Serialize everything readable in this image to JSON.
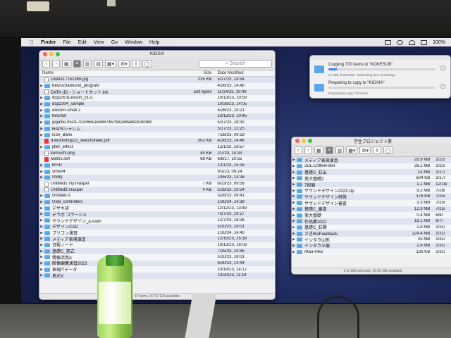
{
  "menubar": {
    "apple_glyph": "",
    "items": [
      "Finder",
      "File",
      "Edit",
      "View",
      "Go",
      "Window",
      "Help"
    ],
    "battery": "100%"
  },
  "main_window": {
    "title": "KIOXIA",
    "search_placeholder": "Search",
    "columns": {
      "name": "Name",
      "size": "Size",
      "date": "Date Modified"
    },
    "rows": [
      {
        "indent": 0,
        "kind": "file",
        "expand": "",
        "name": "1684317152369.jpg",
        "size": "235 KB",
        "date": "5/17/23, 18:54"
      },
      {
        "indent": 0,
        "kind": "folder",
        "expand": "▶",
        "name": "bel2023arduino_program",
        "size": "",
        "date": "4/26/23, 14:46"
      },
      {
        "indent": 0,
        "kind": "file",
        "expand": "",
        "name": "DATA (D) - ショートカット.lnk",
        "size": "503 bytes",
        "date": "11/14/23, 10:49"
      },
      {
        "indent": 0,
        "kind": "folder",
        "expand": "▶",
        "name": "dcp2301Lesson_v1-2",
        "size": "",
        "date": "10/13/23, 10:58"
      },
      {
        "indent": 0,
        "kind": "folder",
        "expand": "▶",
        "name": "dcp2304_sample",
        "size": "",
        "date": "10/26/23, 14:05"
      },
      {
        "indent": 0,
        "kind": "folder",
        "expand": "▶",
        "name": "elecom-small 2",
        "size": "",
        "date": "5/26/23, 10:21"
      },
      {
        "indent": 0,
        "kind": "folder",
        "expand": "▶",
        "name": "forumel",
        "size": "",
        "date": "10/13/23, 10:45"
      },
      {
        "indent": 0,
        "kind": "folder",
        "expand": "▶",
        "name": "gigafile-0524-702c661a53d87467bfe268a8d2818384",
        "size": "",
        "date": "5/17/23, 18:32"
      },
      {
        "indent": 0,
        "kind": "folder",
        "expand": "▶",
        "name": "HAPSシャレム",
        "size": "",
        "date": "5/17/23, 13:25"
      },
      {
        "indent": 0,
        "kind": "folder",
        "expand": "▶",
        "name": "Icon_Bank",
        "size": "",
        "date": "7/28/23, 09:19"
      },
      {
        "indent": 0,
        "kind": "pdf",
        "expand": "",
        "name": "IDworkshop23_sketchsheet.pdf",
        "size": "502 KB",
        "date": "4/26/23, 14:46"
      },
      {
        "indent": 0,
        "kind": "folder",
        "expand": "▶",
        "name": "jitter_effect",
        "size": "",
        "date": "12/1/23, 16:57"
      },
      {
        "indent": 0,
        "kind": "file",
        "expand": "",
        "name": "kemushi.png",
        "size": "40 KB",
        "date": "2/7/23, 14:33"
      },
      {
        "indent": 0,
        "kind": "pdf",
        "expand": "",
        "name": "Matrix.swf",
        "size": "68 KB",
        "date": "6/8/17, 10:55"
      },
      {
        "indent": 0,
        "kind": "folder",
        "expand": "▶",
        "name": "RFID",
        "size": "",
        "date": "12/1/23, 15:16"
      },
      {
        "indent": 0,
        "kind": "folder",
        "expand": "▶",
        "name": "sinw04",
        "size": "",
        "date": "9/1/23, 09:24"
      },
      {
        "indent": 0,
        "kind": "folder",
        "expand": "▶",
        "name": "Utility",
        "size": "",
        "date": "10/6/23, 14:38"
      },
      {
        "indent": 0,
        "kind": "file",
        "expand": "",
        "name": "Untitled1 my.maxpat",
        "size": "7 KB",
        "date": "6/23/23, 09:56"
      },
      {
        "indent": 0,
        "kind": "file",
        "expand": "",
        "name": "Untitled3.maxpat",
        "size": "4 KB",
        "date": "5/19/23, 10:24"
      },
      {
        "indent": 0,
        "kind": "folder",
        "expand": "▶",
        "name": "Untitled-3",
        "size": "",
        "date": "5/26/23, 09:41"
      },
      {
        "indent": 0,
        "kind": "folder",
        "expand": "▶",
        "name": "USB_controllers",
        "size": "",
        "date": "1/30/24, 14:38"
      },
      {
        "indent": 0,
        "kind": "folder",
        "expand": "▶",
        "name": "デザキ研",
        "size": "",
        "date": "12/12/23, 13:49"
      },
      {
        "indent": 0,
        "kind": "folder",
        "expand": "▶",
        "name": "デラボ コラージュ",
        "size": "",
        "date": "7/27/23, 19:17"
      },
      {
        "indent": 0,
        "kind": "folder",
        "expand": "▶",
        "name": "サウンドデザイン_a.room",
        "size": "",
        "date": "12/7/23, 16:26"
      },
      {
        "indent": 0,
        "kind": "folder",
        "expand": "▶",
        "name": "デザインCAD",
        "size": "",
        "date": "5/10/23, 18:01"
      },
      {
        "indent": 0,
        "kind": "folder",
        "expand": "▶",
        "name": "プリコン演習",
        "size": "",
        "date": "1/10/24, 14:40"
      },
      {
        "indent": 0,
        "kind": "folder",
        "expand": "▶",
        "name": "メディア表現演習",
        "size": "",
        "date": "12/15/23, 15:16"
      },
      {
        "indent": 0,
        "kind": "folder",
        "expand": "▶",
        "name": "日程ノード",
        "size": "",
        "date": "10/13/23, 16:03"
      },
      {
        "indent": 0,
        "kind": "folder",
        "expand": "▶",
        "name": "基礎C_書式",
        "size": "",
        "date": "7/25/23, 10:45"
      },
      {
        "indent": 0,
        "kind": "folder",
        "expand": "▶",
        "name": "情報活用A",
        "size": "",
        "date": "5/10/23, 18:01"
      },
      {
        "indent": 0,
        "kind": "folder",
        "expand": "▶",
        "name": "映像編集演習2023",
        "size": "",
        "date": "6/30/23, 14:44"
      },
      {
        "indent": 0,
        "kind": "folder",
        "expand": "▶",
        "name": "表現ITデータ",
        "size": "",
        "date": "10/19/23, 14:17"
      },
      {
        "indent": 0,
        "kind": "folder",
        "expand": "▶",
        "name": "鳥光X",
        "size": "",
        "date": "10/20/23, 11:14"
      }
    ],
    "status": "47 items, 57.97 GB available"
  },
  "copy_dialog": {
    "items": [
      {
        "title": "Copying 700 items to \"KOKESUB\"",
        "subtitle": "1.7 MB of 20.9 MB - Estimating time remaining...",
        "progress": 0.08
      },
      {
        "title": "Preparing to copy to \"KIOXIA\"",
        "subtitle": "Preparing to copy 728 items",
        "progress": 0.0
      }
    ]
  },
  "second_window": {
    "title": "学生プロジェクト素",
    "rows": [
      {
        "name": "メディア表現演習",
        "size": "28.9 MB",
        "date": "2/2/2"
      },
      {
        "name": "2DL.CoffeeFilter",
        "size": "28.1 MB",
        "date": "2/2/2"
      },
      {
        "name": "基礎C_石山",
        "size": "14 MB",
        "date": "1/17/"
      },
      {
        "name": "美大基礎2",
        "size": "604 KB",
        "date": "1/17/"
      },
      {
        "name": "7組展",
        "size": "1.1 MB",
        "date": "12/18/"
      },
      {
        "name": "サウンドデザイン2023.zip",
        "size": "9.2 MB",
        "date": "7/28/"
      },
      {
        "name": "サウンドデザイン特殊",
        "size": "176 KB",
        "date": "7/25/"
      },
      {
        "name": "サウンドデザイン審査",
        "size": "3.3 MB",
        "date": "7/25/"
      },
      {
        "name": "基礎C_審査",
        "size": "12.9 MB",
        "date": "7/25/"
      },
      {
        "name": "美大基礎",
        "size": "0.4 MB",
        "date": "6/8/"
      },
      {
        "name": "作品集2022",
        "size": "18.1 MB",
        "date": "6/7/"
      },
      {
        "name": "基礎C_石関",
        "size": "1.8 MB",
        "date": "1/31/"
      },
      {
        "name": "さきBioFeedback",
        "size": "124.4 MB",
        "date": "1/31/"
      },
      {
        "name": "インタラ山形",
        "size": "25 MB",
        "date": "1/31/"
      },
      {
        "name": "インタラ三展",
        "size": "2.4 MB",
        "date": "1/31/"
      },
      {
        "name": "Atau-Hiko",
        "size": "126 KB",
        "date": "1/31/"
      }
    ],
    "status": "1 of 186 selected, 10.26 GB available"
  },
  "colors": {
    "selection": "#dfe3ef",
    "folder": "#5aa8e8",
    "progress": "#3b82f6",
    "desktop": "#1f2a5c"
  }
}
